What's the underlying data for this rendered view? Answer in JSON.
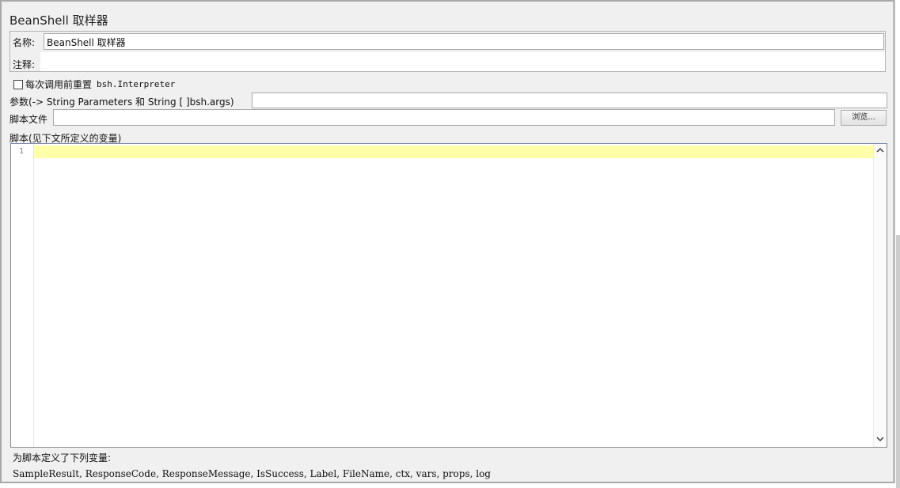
{
  "panel": {
    "title": "BeanShell 取样器"
  },
  "meta": {
    "name_label": "名称:",
    "name_value": "BeanShell 取样器",
    "comment_label": "注释:",
    "comment_value": ""
  },
  "reset": {
    "label_cn": "每次调用前重置",
    "label_code": "bsh.Interpreter",
    "checked": false
  },
  "params": {
    "label": "参数(-> String Parameters 和 String [ ]bsh.args)",
    "value": ""
  },
  "script_file": {
    "label": "脚本文件",
    "value": "",
    "browse_label": "浏览..."
  },
  "script": {
    "label": "脚本(见下文所定义的变量)",
    "line_numbers": [
      "1"
    ],
    "content": "",
    "scroll_up_icon": "chevron-up-icon",
    "scroll_down_icon": "chevron-down-icon",
    "current_line_color": "#ffffaa"
  },
  "variables": {
    "title": "为脚本定义了下列变量:",
    "list": "SampleResult, ResponseCode, ResponseMessage, IsSuccess, Label, FileName, ctx, vars, props, log"
  }
}
